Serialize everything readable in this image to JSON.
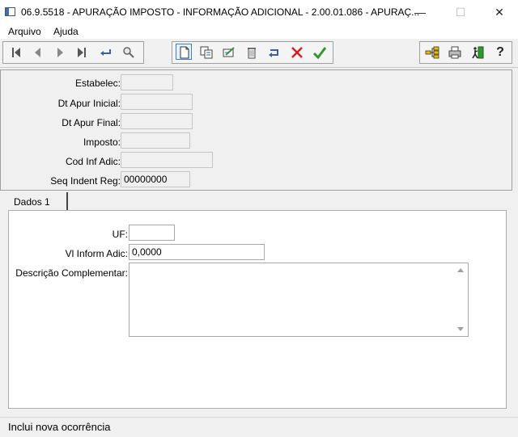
{
  "window": {
    "title": "06.9.5518 - APURAÇÃO IMPOSTO - INFORMAÇÃO ADICIONAL - 2.00.01.086 - APURAÇ...",
    "minimize": "—",
    "maximize": "☐",
    "close": "✕"
  },
  "menu": {
    "items": [
      "Arquivo",
      "Ajuda"
    ]
  },
  "toolbar": {
    "icons": [
      "first-record-icon",
      "previous-record-icon",
      "next-record-icon",
      "last-record-icon",
      "goto-icon",
      "search-icon",
      "new-document-icon",
      "copy-icon",
      "edit-icon",
      "delete-icon",
      "undo-icon",
      "cancel-icon",
      "confirm-icon",
      "tree-icon",
      "print-icon",
      "exit-icon",
      "help-icon"
    ],
    "help_label": "?"
  },
  "header_form": {
    "estabelec_label": "Estabelec:",
    "estabelec_value": "",
    "dt_apur_inicial_label": "Dt Apur Inicial:",
    "dt_apur_inicial_value": "",
    "dt_apur_final_label": "Dt Apur Final:",
    "dt_apur_final_value": "",
    "imposto_label": "Imposto:",
    "imposto_value": "",
    "cod_inf_adic_label": "Cod Inf Adic:",
    "cod_inf_adic_value": "",
    "seq_indent_reg_label": "Seq Indent Reg:",
    "seq_indent_reg_value": "00000000"
  },
  "tabs": [
    {
      "label": "Dados 1",
      "active": true
    }
  ],
  "dados1": {
    "uf_label": "UF:",
    "uf_value": "",
    "vl_inform_adic_label": "Vl Inform Adic:",
    "vl_inform_adic_value": "0,0000",
    "descricao_label": "Descrição Complementar:",
    "descricao_value": ""
  },
  "status": {
    "text": "Inclui nova ocorrência"
  },
  "colors": {
    "accent_blue": "#3b7fd4",
    "cancel_red": "#d42020",
    "confirm_green": "#2e9a2e"
  }
}
